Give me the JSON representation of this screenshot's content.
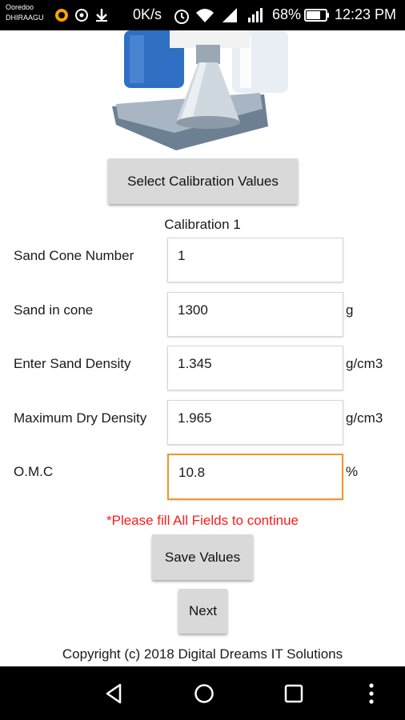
{
  "status_bar": {
    "carrier_line1": "Ooredoo",
    "carrier_line2": "DHIRAAGU",
    "net_speed": "0K/s",
    "battery": "68%",
    "time": "12:23 PM"
  },
  "hero_image": {
    "icon": "sand-cone-apparatus-icon"
  },
  "select_button": {
    "label": "Select Calibration Values"
  },
  "calibration_title": "Calibration 1",
  "fields": [
    {
      "label": "Sand Cone Number",
      "value": "1",
      "unit": ""
    },
    {
      "label": "Sand in cone",
      "value": "1300",
      "unit": "g"
    },
    {
      "label": "Enter Sand Density",
      "value": "1.345",
      "unit": "g/cm3"
    },
    {
      "label": "Maximum Dry Density",
      "value": "1.965",
      "unit": "g/cm3"
    },
    {
      "label": "O.M.C",
      "value": "10.8",
      "unit": "%"
    }
  ],
  "warning": "*Please fill All Fields to continue",
  "save_button": {
    "label": "Save Values"
  },
  "next_button": {
    "label": "Next"
  },
  "copyright": "Copyright (c) 2018 Digital Dreams IT Solutions",
  "colors": {
    "focus_border": "#f0972b",
    "warning_text": "#ff1a1a",
    "button_bg": "#d9d9d9"
  }
}
